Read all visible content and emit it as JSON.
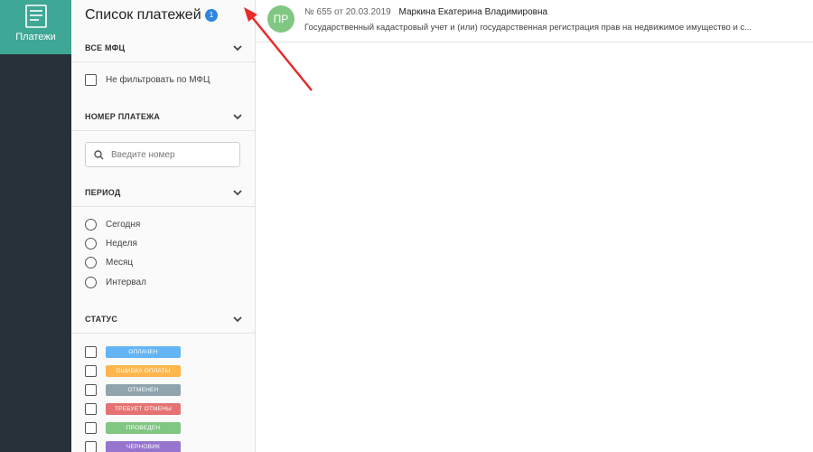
{
  "nav": {
    "payments_label": "Платежи",
    "payments_icon": "document-list-icon"
  },
  "sidebar": {
    "title": "Список платежей",
    "badge_count": "1",
    "mfc": {
      "heading": "ВСЕ МФЦ",
      "no_filter_label": "Не фильтровать по МФЦ"
    },
    "number": {
      "heading": "НОМЕР ПЛАТЕЖА",
      "placeholder": "Введите номер"
    },
    "period": {
      "heading": "ПЕРИОД",
      "options": [
        "Сегодня",
        "Неделя",
        "Месяц",
        "Интервал"
      ]
    },
    "status": {
      "heading": "СТАТУС",
      "items": [
        {
          "label": "ОПЛАЧЕН",
          "color": "#64b5f6"
        },
        {
          "label": "ОШИБКА ОПЛАТЫ",
          "color": "#ffb74d"
        },
        {
          "label": "ОТМЕНЕН",
          "color": "#90a4ae"
        },
        {
          "label": "ТРЕБУЕТ ОТМЕНЫ",
          "color": "#e57373"
        },
        {
          "label": "ПРОВЕДЕН",
          "color": "#81c784"
        },
        {
          "label": "ЧЕРНОВИК",
          "color": "#9575cd"
        }
      ]
    }
  },
  "payments": [
    {
      "avatar": "ПР",
      "avatar_color": "#81c784",
      "number": "№ 655",
      "date_prefix": "от",
      "date": "20.03.2019",
      "name": "Маркина Екатерина Владимировна",
      "description": "Государственный кадастровый учет и (или) государственная регистрация прав на недвижимое имущество и с..."
    }
  ],
  "colors": {
    "rail_bg": "#263238",
    "rail_active": "#3fa796",
    "badge": "#2f86de",
    "annotation_arrow": "#e82a2a"
  }
}
